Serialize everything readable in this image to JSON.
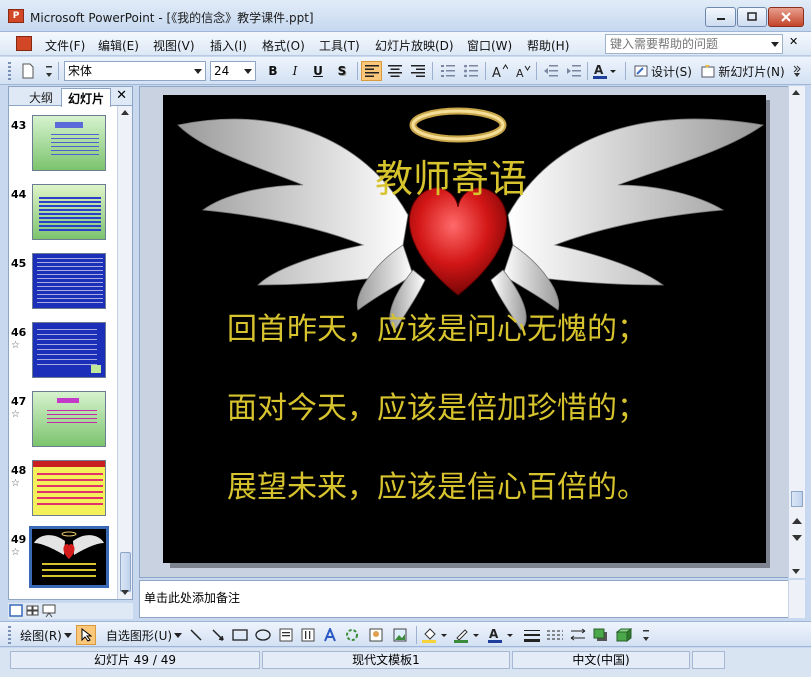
{
  "window": {
    "title": "Microsoft PowerPoint - [《我的信念》教学课件.ppt]"
  },
  "menu": {
    "items": [
      "文件(F)",
      "编辑(E)",
      "视图(V)",
      "插入(I)",
      "格式(O)",
      "工具(T)",
      "幻灯片放映(D)",
      "窗口(W)",
      "帮助(H)"
    ],
    "help_placeholder": "键入需要帮助的问题"
  },
  "toolbar": {
    "font_name": "宋体",
    "font_size": "24",
    "bold": "B",
    "italic": "I",
    "underline": "U",
    "shadow": "S",
    "design_label": "设计(S)",
    "new_slide_label": "新幻灯片(N)"
  },
  "left_pane": {
    "tabs": [
      "大纲",
      "幻灯片"
    ],
    "slides": [
      {
        "number": "43",
        "starred": false
      },
      {
        "number": "44",
        "starred": false
      },
      {
        "number": "45",
        "starred": false
      },
      {
        "number": "46",
        "starred": true
      },
      {
        "number": "47",
        "starred": true
      },
      {
        "number": "48",
        "starred": true
      },
      {
        "number": "49",
        "starred": true
      }
    ],
    "star_glyph": "☆"
  },
  "slide": {
    "title": "教师寄语",
    "lines": [
      "回首昨天，应该是问心无愧的；",
      "面对今天，应该是倍加珍惜的；",
      "展望未来，应该是信心百倍的。"
    ]
  },
  "notes": {
    "placeholder": "单击此处添加备注"
  },
  "drawbar": {
    "draw_label": "绘图(R)",
    "autoshapes_label": "自选图形(U)"
  },
  "status": {
    "slide_position": "幻灯片 49 / 49",
    "template": "现代文模板1",
    "language": "中文(中国)"
  },
  "colors": {
    "slide_text": "#d7c32d",
    "selection": "#3a69b5"
  }
}
